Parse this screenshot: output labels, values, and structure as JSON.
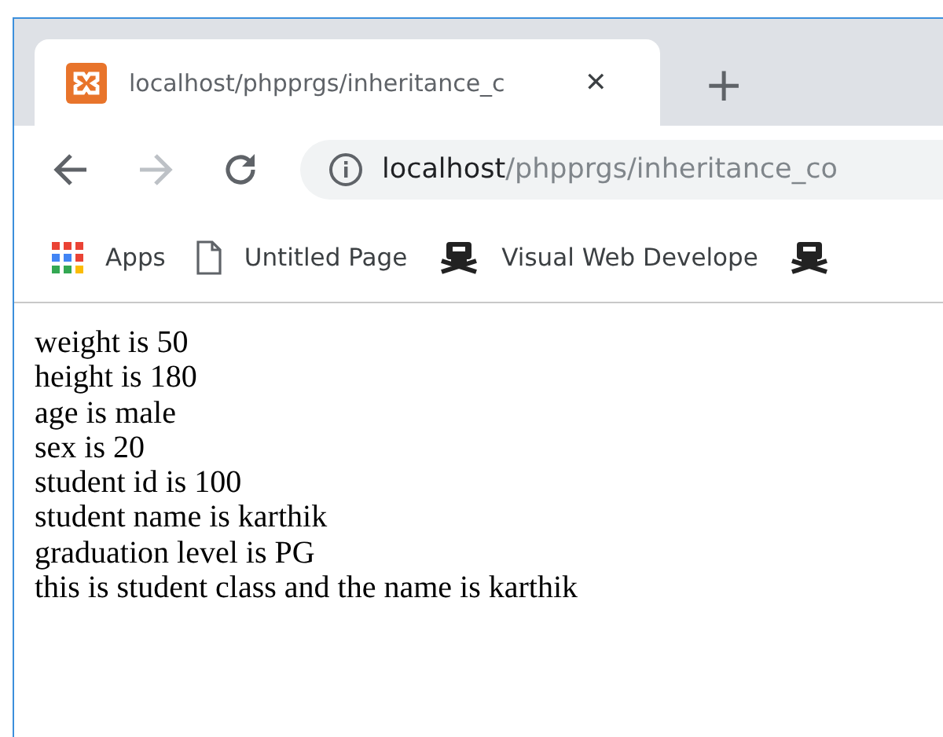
{
  "tab": {
    "title": "localhost/phpprgs/inheritance_c",
    "close": "✕",
    "new_tab": "+"
  },
  "toolbar": {
    "back": {
      "disabled": false
    },
    "forward": {
      "disabled": true
    },
    "url_host": "localhost",
    "url_path": "/phpprgs/inheritance_co"
  },
  "bookmarks": [
    {
      "kind": "apps",
      "label": "Apps"
    },
    {
      "kind": "page",
      "label": "Untitled Page"
    },
    {
      "kind": "pirate",
      "label": "Visual Web Develope"
    },
    {
      "kind": "pirate"
    }
  ],
  "content": {
    "lines": [
      "weight is 50",
      "height is 180",
      "age is male",
      "sex is 20",
      "student id is 100",
      "student name is karthik",
      "graduation level is PG",
      "this is student class and the name is karthik"
    ]
  }
}
